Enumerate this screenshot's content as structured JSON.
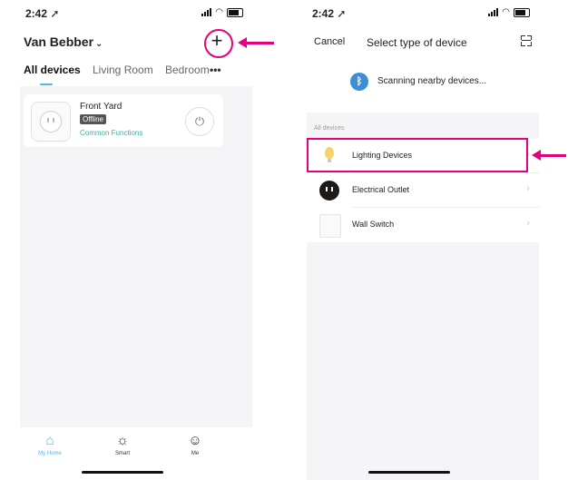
{
  "left_phone": {
    "status": {
      "time": "2:42",
      "location_icon": "location-arrow-icon"
    },
    "home": {
      "name": "Van Bebber",
      "add_symbol": "+"
    },
    "tabs": [
      {
        "label": "All devices"
      },
      {
        "label": "Living Room"
      },
      {
        "label": "Bedroom"
      }
    ],
    "more_symbol": "•••",
    "device": {
      "name": "Front Yard",
      "status": "Offline",
      "function": "Common Functions",
      "power_icon": "power-icon"
    },
    "nav": [
      {
        "label": "My Home",
        "icon": "home-icon"
      },
      {
        "label": "Smart",
        "icon": "sun-icon"
      },
      {
        "label": "Me",
        "icon": "user-icon"
      }
    ]
  },
  "right_phone": {
    "status": {
      "time": "2:42"
    },
    "top_bar": {
      "cancel": "Cancel",
      "title": "Select type of device"
    },
    "scan": {
      "text": "Scanning nearby devices..."
    },
    "section_label": "All devices",
    "device_types": [
      {
        "label": "Lighting Devices",
        "icon": "bulb-icon"
      },
      {
        "label": "Electrical Outlet",
        "icon": "outlet-icon"
      },
      {
        "label": "Wall Switch",
        "icon": "wall-switch-icon"
      }
    ]
  },
  "colors": {
    "accent": "#4fb8e6",
    "annotation": "#e5007e",
    "function_text": "#3fb39d",
    "bluetooth": "#3c8fd6"
  }
}
